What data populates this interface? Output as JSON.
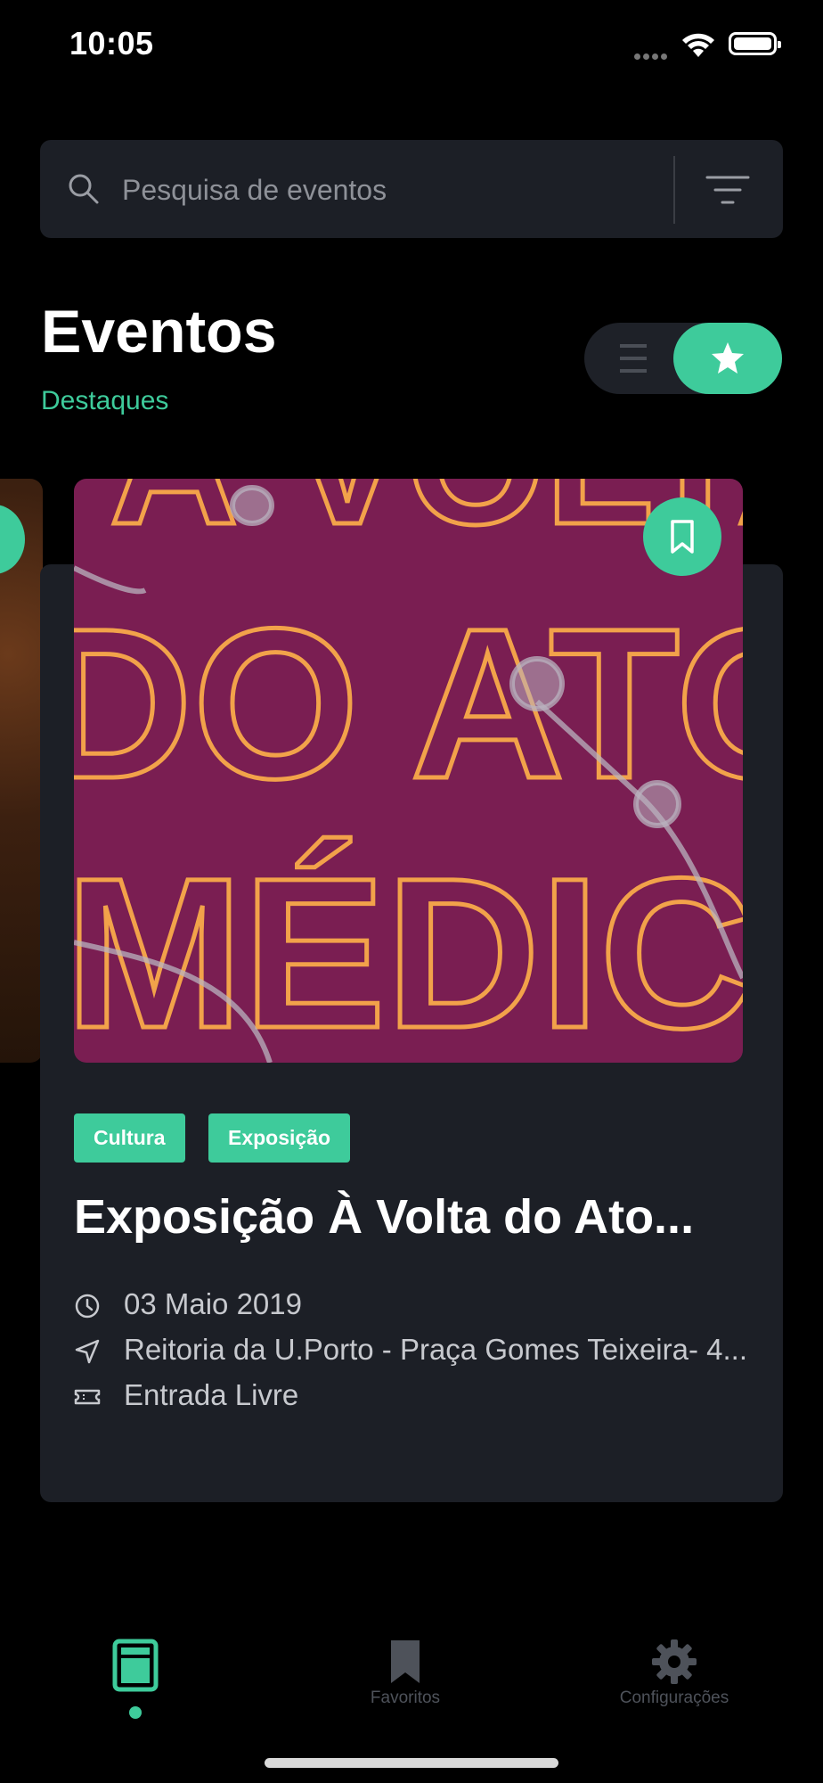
{
  "status_bar": {
    "time": "10:05"
  },
  "search": {
    "placeholder": "Pesquisa de eventos"
  },
  "header": {
    "title": "Eventos",
    "subtitle": "Destaques"
  },
  "event_card": {
    "tags": [
      "Cultura",
      "Exposição"
    ],
    "title": "Exposição À Volta do Ato...",
    "date": "03 Maio 2019",
    "location": "Reitoria da U.Porto - Praça Gomes Teixeira- 4...",
    "price": "Entrada Livre",
    "poster_text": [
      "À VOLTA",
      "DO ATO",
      "MÉDICO"
    ]
  },
  "bottom_nav": {
    "items": [
      {
        "label": "",
        "icon": "events-icon",
        "active": true
      },
      {
        "label": "Favoritos",
        "icon": "bookmark-icon",
        "active": false
      },
      {
        "label": "Configurações",
        "icon": "gear-icon",
        "active": false
      }
    ]
  },
  "colors": {
    "accent": "#3ecb9b",
    "surface": "#1c1f26",
    "background": "#000000",
    "poster": "#7a1e52"
  }
}
